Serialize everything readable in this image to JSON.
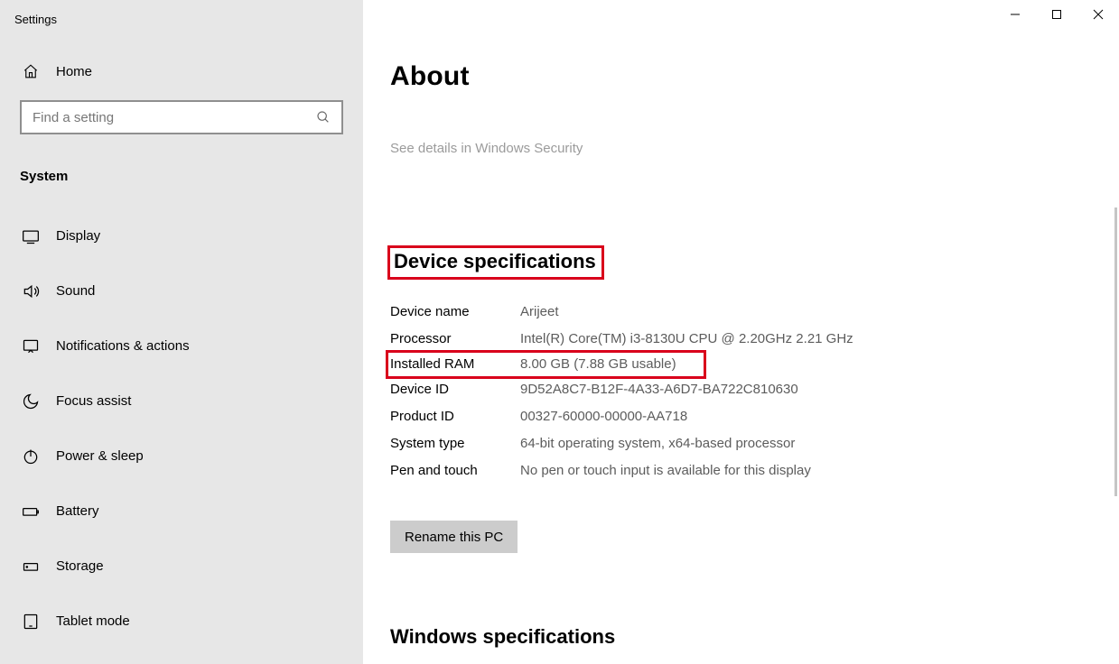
{
  "appTitle": "Settings",
  "homeLabel": "Home",
  "searchPlaceholder": "Find a setting",
  "sectionLabel": "System",
  "nav": [
    {
      "label": "Display"
    },
    {
      "label": "Sound"
    },
    {
      "label": "Notifications & actions"
    },
    {
      "label": "Focus assist"
    },
    {
      "label": "Power & sleep"
    },
    {
      "label": "Battery"
    },
    {
      "label": "Storage"
    },
    {
      "label": "Tablet mode"
    }
  ],
  "page": {
    "heading": "About",
    "securityLink": "See details in Windows Security",
    "deviceSpecsHeading": "Device specifications",
    "specs": {
      "deviceName": {
        "k": "Device name",
        "v": "Arijeet"
      },
      "processor": {
        "k": "Processor",
        "v": "Intel(R) Core(TM) i3-8130U CPU @ 2.20GHz   2.21 GHz"
      },
      "installedRam": {
        "k": "Installed RAM",
        "v": "8.00 GB (7.88 GB usable)"
      },
      "deviceId": {
        "k": "Device ID",
        "v": "9D52A8C7-B12F-4A33-A6D7-BA722C810630"
      },
      "productId": {
        "k": "Product ID",
        "v": "00327-60000-00000-AA718"
      },
      "systemType": {
        "k": "System type",
        "v": "64-bit operating system, x64-based processor"
      },
      "penTouch": {
        "k": "Pen and touch",
        "v": "No pen or touch input is available for this display"
      }
    },
    "renameBtn": "Rename this PC",
    "winSpecsHeading": "Windows specifications"
  }
}
